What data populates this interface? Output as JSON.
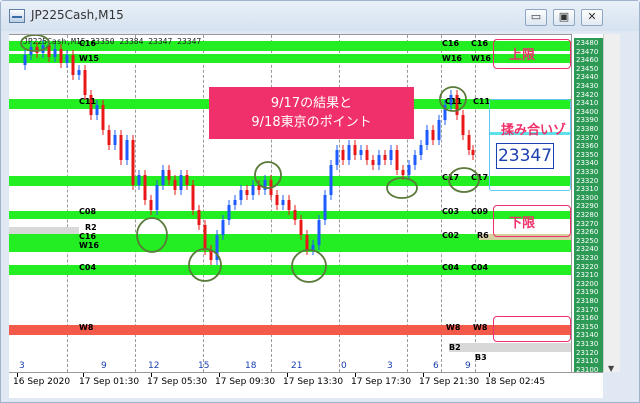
{
  "window": {
    "title": "JP225Cash,M15",
    "minimize_label": "▭",
    "restore_label": "▣",
    "close_label": "✕"
  },
  "chart": {
    "header": "JP225Cash,M15  23350 23384 23347 23347",
    "callout_lines": [
      "9/17の結果と",
      "9/18東京のポイント"
    ],
    "upper_limit": "上限",
    "range_zone": "揉み合いゾーン",
    "lower_limit": "下限",
    "current_price": "23347",
    "levels": {
      "c16_left": "C16",
      "w15_left": "W15",
      "c11_left": "C11",
      "c08_left": "C08",
      "r2_left": "R2",
      "c16b_left": "C16",
      "w16_left": "W16",
      "c04_left": "C04",
      "w8_left": "W8",
      "c16_right1": "C16",
      "c16_right2": "C16",
      "w16_right1": "W16",
      "w16_right2": "W16",
      "c11_right1": "C11",
      "c11_right2": "C11",
      "c17_right1": "C17",
      "c17_right2": "C17",
      "c03_right1": "C03",
      "c03_right2": "C09",
      "c02_right1": "C02",
      "r6_right2": "R6",
      "c04_right1": "C04",
      "c04_right2": "C04",
      "w8_right1": "W8",
      "w8_right2": "W8",
      "b2_right": "B2",
      "b3_right": "B3"
    }
  },
  "price_axis": [
    "23480",
    "23470",
    "23460",
    "23450",
    "23440",
    "23430",
    "23420",
    "23410",
    "23400",
    "23390",
    "23380",
    "23370",
    "23360",
    "23350",
    "23340",
    "23330",
    "23320",
    "23310",
    "23300",
    "23290",
    "23280",
    "23270",
    "23260",
    "23250",
    "23240",
    "23230",
    "23220",
    "23210",
    "23200",
    "23190",
    "23180",
    "23170",
    "23160",
    "23150",
    "23140",
    "23130",
    "23120",
    "23110",
    "23100"
  ],
  "time_axis": {
    "numbers": [
      "3",
      "9",
      "12",
      "15",
      "18",
      "21",
      "0",
      "3",
      "6",
      "9"
    ],
    "dates": [
      "16 Sep 2020",
      "17 Sep 01:30",
      "17 Sep 05:30",
      "17 Sep 09:30",
      "17 Sep 13:30",
      "17 Sep 17:30",
      "17 Sep 21:30",
      "18 Sep 02:45"
    ]
  },
  "colors": {
    "accent": "#f0306a",
    "support_band": "#22ee22",
    "resistance_band": "#f45a4a",
    "bull_candle": "#1e5cff",
    "bear_candle": "#e81818",
    "marker": "#5a7a3a"
  }
}
